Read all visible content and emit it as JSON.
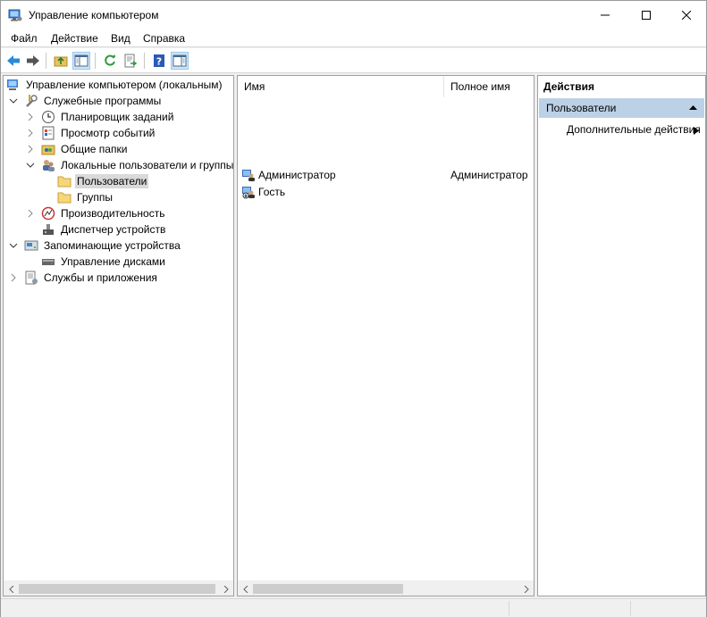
{
  "window": {
    "title": "Управление компьютером"
  },
  "menu": [
    {
      "label": "Файл"
    },
    {
      "label": "Действие"
    },
    {
      "label": "Вид"
    },
    {
      "label": "Справка"
    }
  ],
  "toolbar": {
    "buttons": [
      "back-icon",
      "forward-icon",
      "up-folder-icon",
      "show-hide-tree-icon",
      "refresh-icon",
      "export-list-icon",
      "help-icon",
      "show-action-pane-icon"
    ]
  },
  "tree": {
    "items": [
      {
        "label": "Управление компьютером (локальным)"
      },
      {
        "label": "Служебные программы"
      },
      {
        "label": "Планировщик заданий"
      },
      {
        "label": "Просмотр событий"
      },
      {
        "label": "Общие папки"
      },
      {
        "label": "Локальные пользователи и группы"
      },
      {
        "label": "Пользователи"
      },
      {
        "label": "Группы"
      },
      {
        "label": "Производительность"
      },
      {
        "label": "Диспетчер устройств"
      },
      {
        "label": "Запоминающие устройства"
      },
      {
        "label": "Управление дисками"
      },
      {
        "label": "Службы и приложения"
      }
    ]
  },
  "list": {
    "columns": [
      "Имя",
      "Полное имя"
    ],
    "rows": [
      {
        "name": "Администратор",
        "full_name": "Администратор"
      },
      {
        "name": "Гость",
        "full_name": ""
      }
    ]
  },
  "actions": {
    "header": "Действия",
    "section": "Пользователи",
    "items": [
      "Дополнительные действия"
    ]
  },
  "colors": {
    "selection": "#d9d9d9",
    "action_section": "#bcd1e6",
    "accent_blue": "#1e72c8"
  }
}
